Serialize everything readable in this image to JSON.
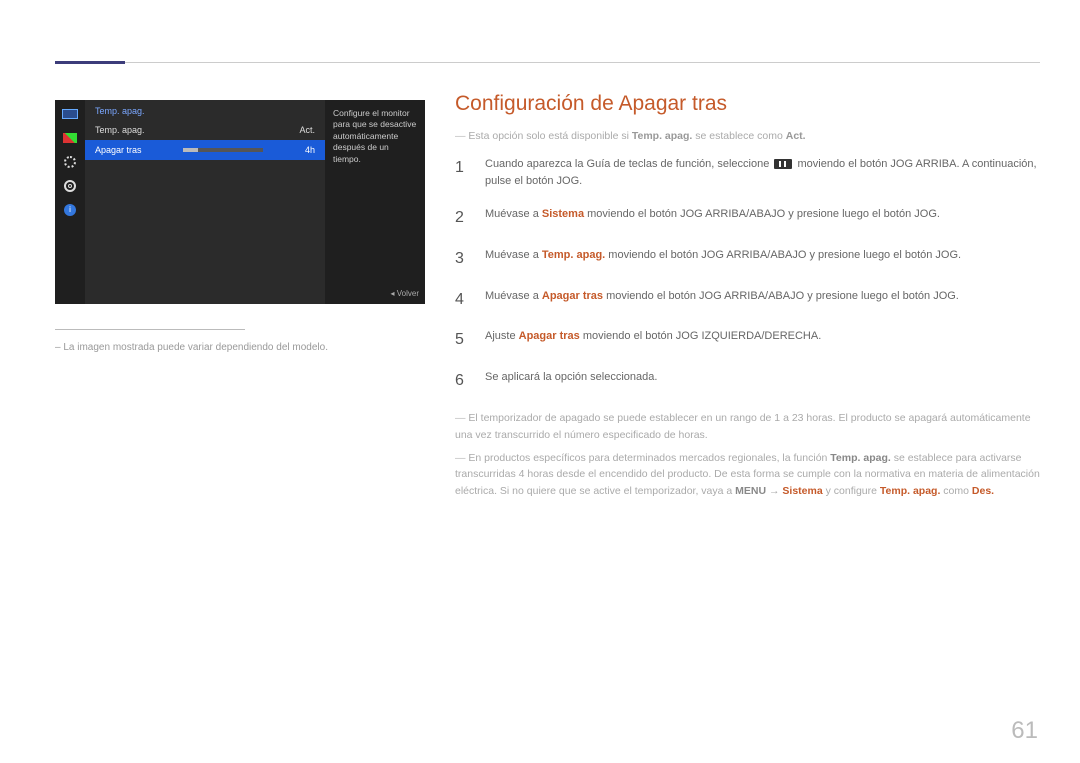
{
  "osd": {
    "title": "Temp. apag.",
    "row1_label": "Temp. apag.",
    "row1_value": "Act.",
    "row2_label": "Apagar tras",
    "row2_value": "4h",
    "description": "Configure el monitor para que se desactive automáticamente después de un tiempo.",
    "back": "Volver",
    "info_glyph": "i"
  },
  "left_footnote": "La imagen mostrada puede variar dependiendo del modelo.",
  "heading": "Configuración de Apagar tras",
  "intro_note": {
    "pre": "Esta opción solo está disponible si ",
    "b1": "Temp. apag.",
    "mid": " se establece como ",
    "b2": "Act."
  },
  "steps": {
    "s1a": "Cuando aparezca la Guía de teclas de función, seleccione ",
    "s1b": " moviendo el botón JOG ARRIBA. A continuación, pulse el botón JOG.",
    "s2a": "Muévase a ",
    "s2b": "Sistema",
    "s2c": " moviendo el botón JOG ARRIBA/ABAJO y presione luego el botón JOG.",
    "s3a": "Muévase a ",
    "s3b": "Temp. apag.",
    "s3c": " moviendo el botón JOG ARRIBA/ABAJO y presione luego el botón JOG.",
    "s4a": "Muévase a ",
    "s4b": "Apagar tras",
    "s4c": " moviendo el botón JOG ARRIBA/ABAJO y presione luego el botón JOG.",
    "s5a": "Ajuste ",
    "s5b": "Apagar tras",
    "s5c": " moviendo el botón JOG IZQUIERDA/DERECHA.",
    "s6": "Se aplicará la opción seleccionada."
  },
  "numbers": {
    "n1": "1",
    "n2": "2",
    "n3": "3",
    "n4": "4",
    "n5": "5",
    "n6": "6"
  },
  "note1": "El temporizador de apagado se puede establecer en un rango de 1 a 23 horas. El producto se apagará automáticamente una vez transcurrido el número especificado de horas.",
  "note2": {
    "a": "En productos específicos para determinados mercados regionales, la función ",
    "b": "Temp. apag.",
    "c": " se establece para activarse transcurridas 4 horas desde el encendido del producto. De esta forma se cumple con la normativa en materia de alimentación eléctrica. Si no quiere que se active el temporizador, vaya a ",
    "menu": "MENU",
    "arrow": " → ",
    "sis": "Sistema",
    "d": " y configure ",
    "e": "Temp. apag.",
    "f": " como ",
    "des": "Des."
  },
  "page_number": "61"
}
